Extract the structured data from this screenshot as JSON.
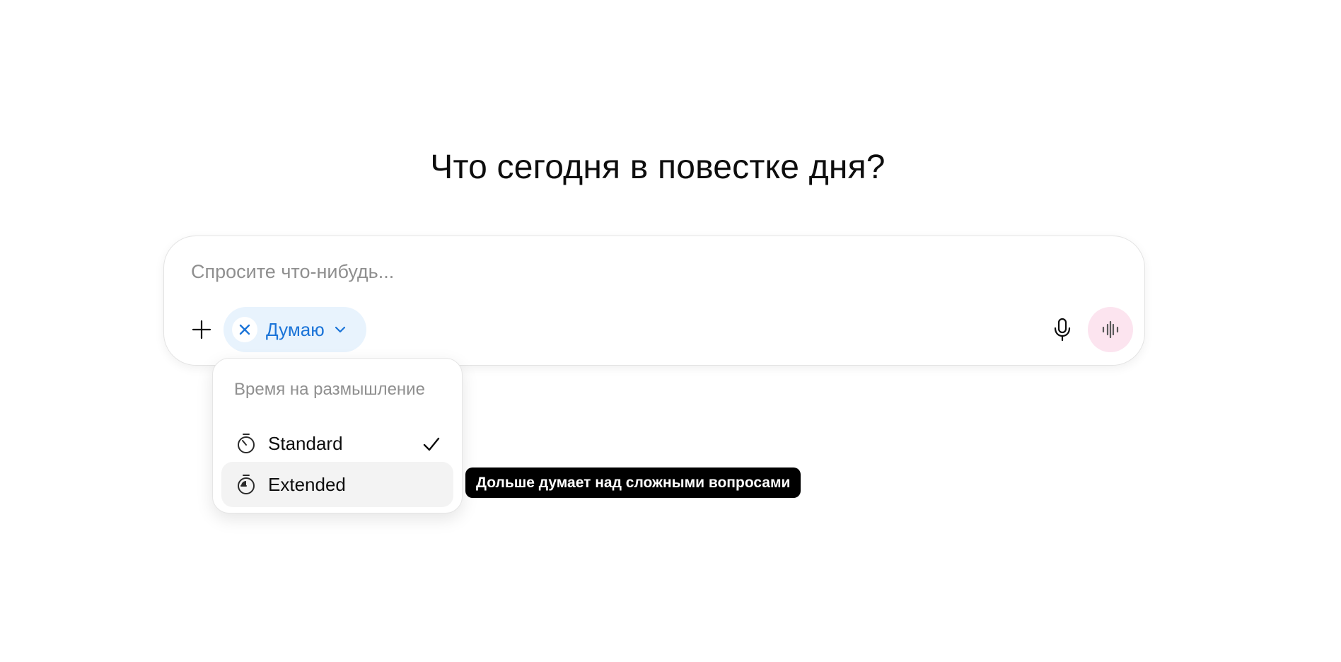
{
  "headline": "Что сегодня в повестке дня?",
  "composer": {
    "placeholder": "Спросите что-нибудь...",
    "value": "",
    "think_chip": {
      "label": "Думаю",
      "color": "#1b74d8",
      "background": "#e8f3fd"
    },
    "icons": {
      "attach": "plus-icon",
      "remove_chip": "close-icon",
      "chip_menu": "chevron-down-icon",
      "dictate": "microphone-icon",
      "voice_mode": "voice-waveform-icon"
    },
    "voice_button_color": "#fce4ef"
  },
  "thinking_menu": {
    "header": "Время на размышление",
    "items": [
      {
        "label": "Standard",
        "icon": "stopwatch-icon",
        "selected": true,
        "hovered": false
      },
      {
        "label": "Extended",
        "icon": "stopwatch-icon",
        "selected": false,
        "hovered": true
      }
    ]
  },
  "tooltip": {
    "text": "Дольше думает над сложными вопросами"
  }
}
